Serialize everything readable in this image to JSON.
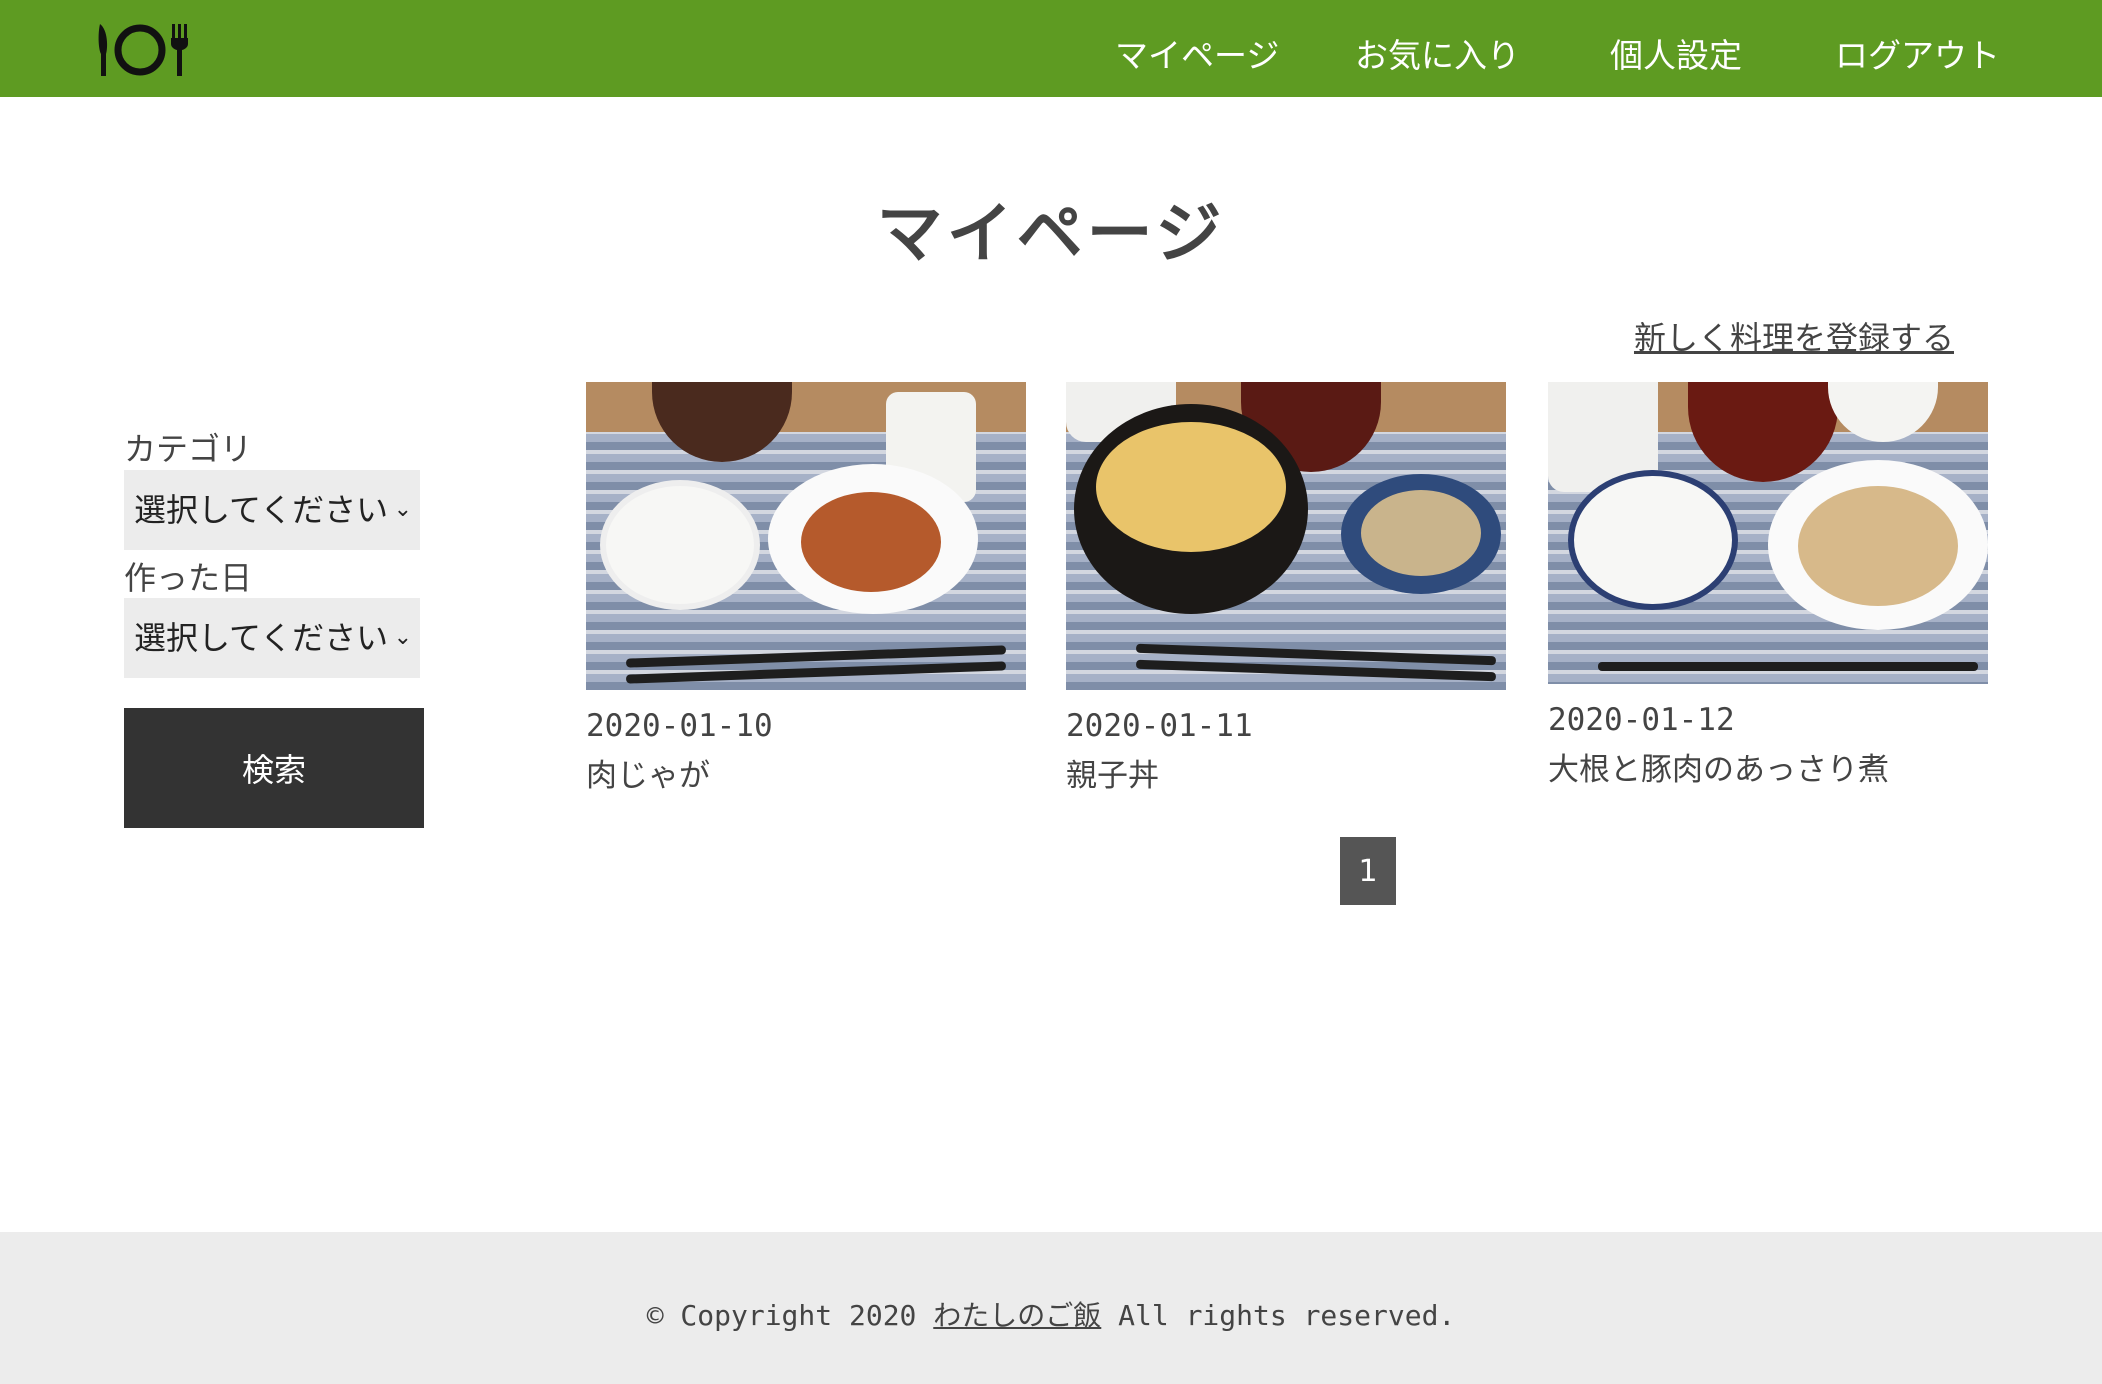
{
  "header": {
    "logo_icon": "plate-and-cutlery-icon",
    "nav": [
      "マイページ",
      "お気に入り",
      "個人設定",
      "ログアウト"
    ]
  },
  "page_title": "マイページ",
  "register_link": "新しく料理を登録する",
  "filters": {
    "category_label": "カテゴリ",
    "category_value": "選択してください",
    "date_label": "作った日",
    "date_value": "選択してください",
    "search_button": "検索"
  },
  "dishes": [
    {
      "date": "2020-01-10",
      "name": "肉じゃが"
    },
    {
      "date": "2020-01-11",
      "name": "親子丼"
    },
    {
      "date": "2020-01-12",
      "name": "大根と豚肉のあっさり煮"
    }
  ],
  "pagination": {
    "current": "1"
  },
  "footer": {
    "copyright_prefix": "© Copyright 2020 ",
    "site_name": "わたしのご飯",
    "copyright_suffix": " All rights reserved."
  },
  "colors": {
    "header": "#5e9b22",
    "button": "#333333",
    "footer": "#ececec"
  }
}
